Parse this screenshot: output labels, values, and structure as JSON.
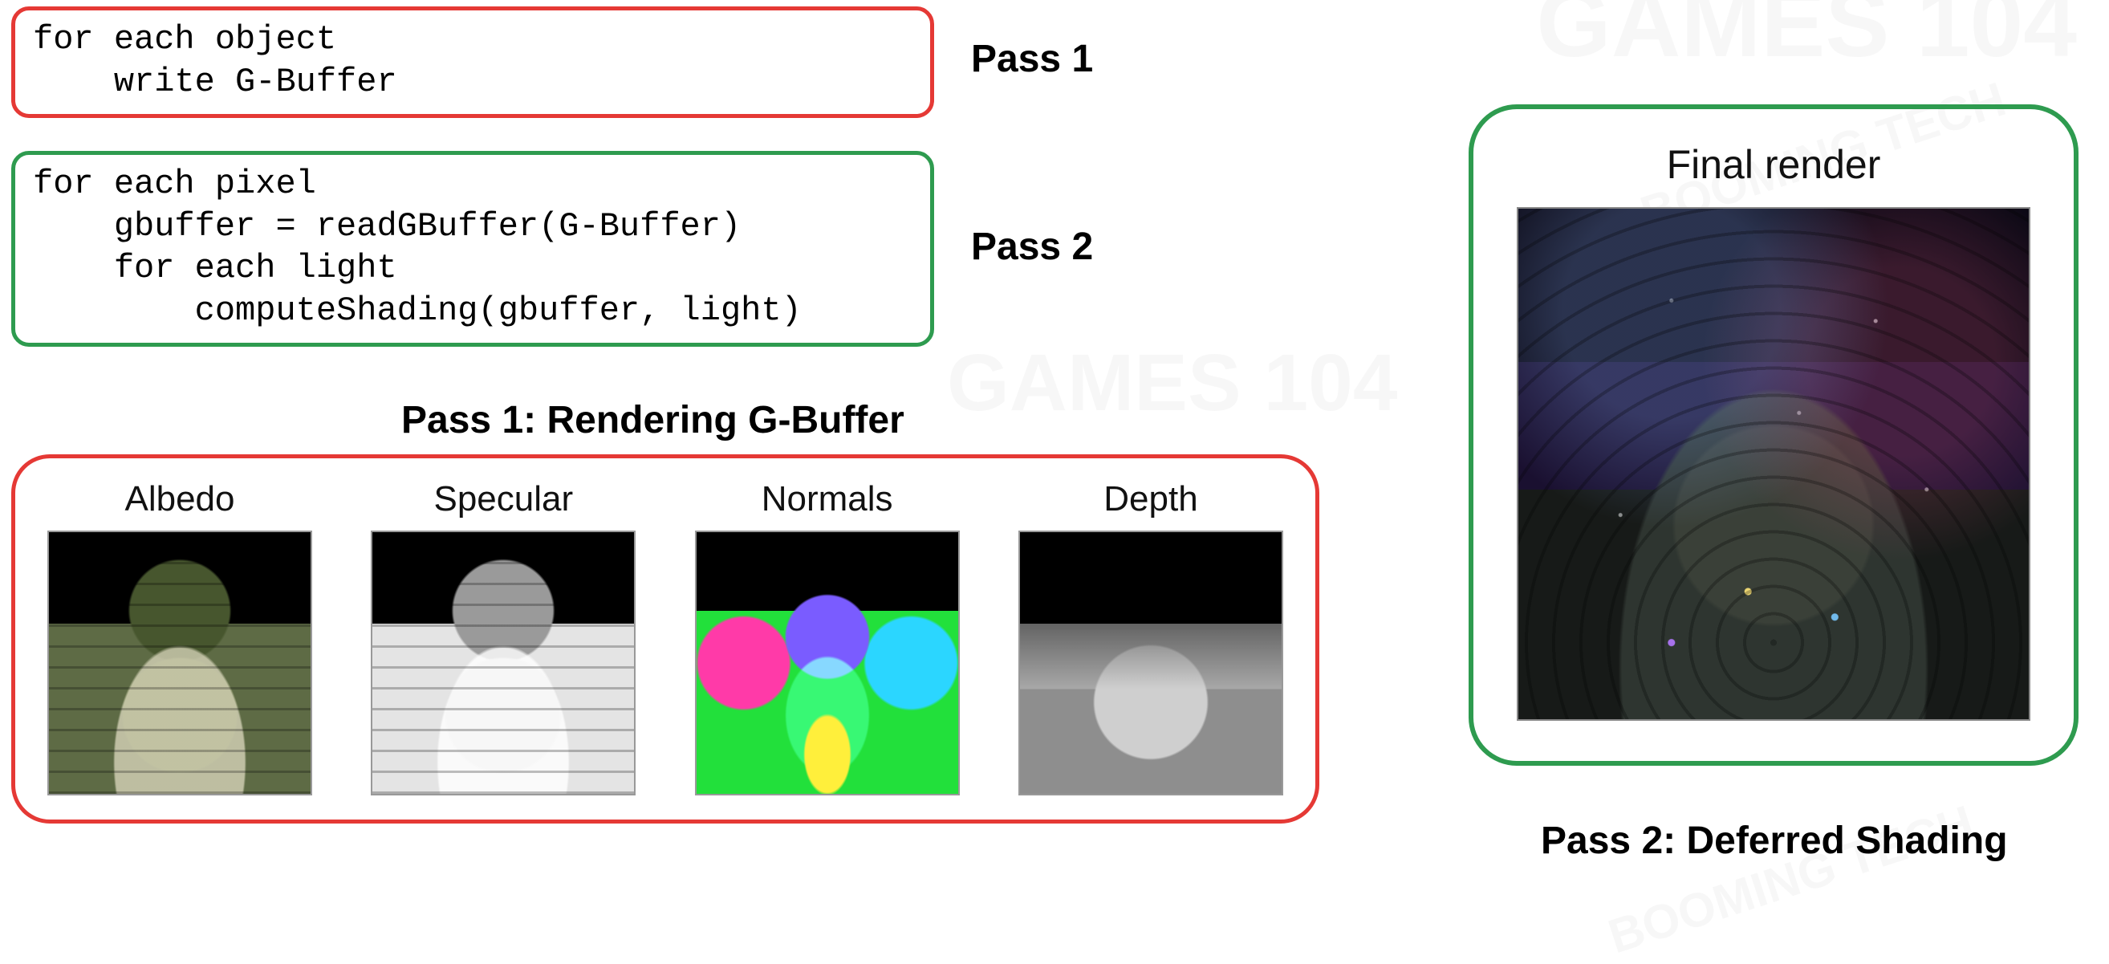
{
  "passes": {
    "pass1_label": "Pass 1",
    "pass2_label": "Pass 2"
  },
  "code": {
    "pass1": "for each object\n    write G-Buffer",
    "pass2": "for each pixel\n    gbuffer = readGBuffer(G-Buffer)\n    for each light\n        computeShading(gbuffer, light)"
  },
  "gbuffer_section": {
    "title": "Pass 1: Rendering G-Buffer",
    "buffers": [
      {
        "label": "Albedo"
      },
      {
        "label": "Specular"
      },
      {
        "label": "Normals"
      },
      {
        "label": "Depth"
      }
    ]
  },
  "final_section": {
    "caption": "Final render",
    "title": "Pass 2: Deferred Shading"
  },
  "watermarks": [
    "GAMES 104",
    "BOOMING TECH"
  ]
}
